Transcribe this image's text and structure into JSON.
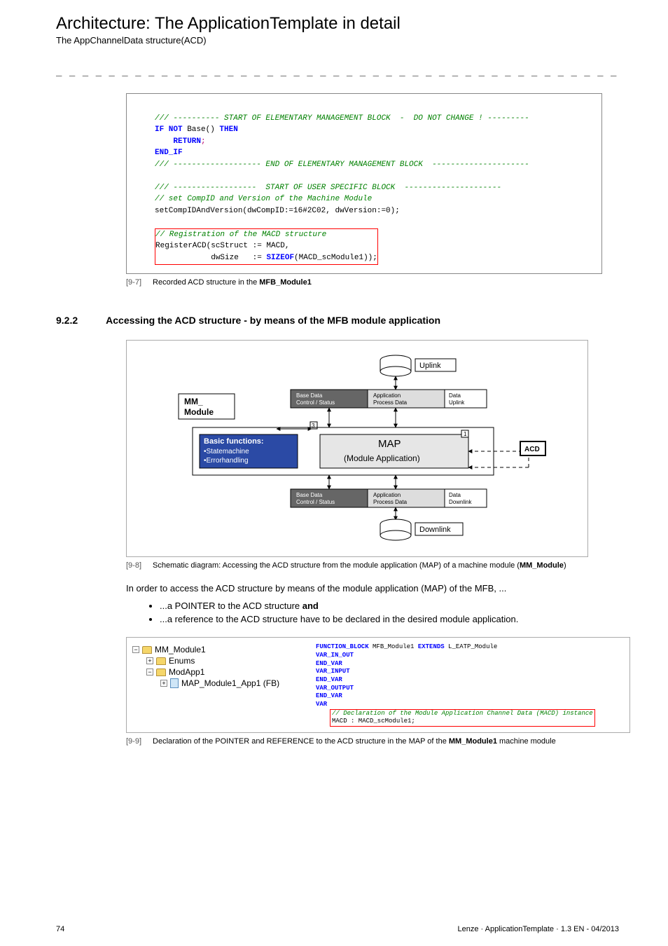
{
  "header": {
    "title": "Architecture: The ApplicationTemplate in detail",
    "subtitle": "The AppChannelData structure(ACD)"
  },
  "dashes": "_ _ _ _ _ _ _ _ _ _ _ _ _ _ _ _ _ _ _ _ _ _ _ _ _ _ _ _ _ _ _ _ _ _ _ _ _ _ _ _ _ _ _ _ _ _ _ _ _ _ _ _ _ _ _ _ _ _ _ _ _ _ _ _",
  "code1": {
    "l1": "/// ---------- START OF ELEMENTARY MANAGEMENT BLOCK  -  DO NOT CHANGE ! ---------",
    "l2a": "IF NOT",
    "l2b": " Base() ",
    "l2c": "THEN",
    "l3": "RETURN",
    "l4": "END_IF",
    "l5": "/// ------------------- END OF ELEMENTARY MANAGEMENT BLOCK  ---------------------",
    "l6": "/// ------------------  START OF USER SPECIFIC BLOCK  ---------------------",
    "l7": "// set CompID and Version of the Machine Module",
    "l8": "setCompIDAndVersion(dwCompID:=16#2C02, dwVersion:=0);",
    "l9": "// Registration of the MACD structure",
    "l10": "RegisterACD(scStruct := MACD,",
    "l11a": "            dwSize   := ",
    "l11b": "SIZEOF",
    "l11c": "(MACD_scModule1));"
  },
  "fig97": {
    "id": "[9-7]",
    "text_a": "Recorded ACD structure in the ",
    "text_b": "MFB_Module1"
  },
  "section922": {
    "num": "9.2.2",
    "title": "Accessing the ACD structure - by means of the MFB module application"
  },
  "diagram": {
    "uplink": "Uplink",
    "mm": "MM_\nModule",
    "basedata1": "Base Data\nControl / Status",
    "app1": "Application\nProcess Data",
    "datauplink": "Data\nUplink",
    "basic": "Basic functions:",
    "basic_b1": "•Statemachine",
    "basic_b2": "•Errorhandling",
    "map": "MAP",
    "mapsub": "(Module Application)",
    "acd": "ACD",
    "basedata2": "Base Data\nControl / Status",
    "app2": "Application\nProcess Data",
    "datadown": "Data\nDownlink",
    "downlink": "Downlink"
  },
  "fig98": {
    "id": "[9-8]",
    "text_a": "Schematic diagram: Accessing the ACD structure from the module application (MAP) of a machine module (",
    "text_b": "MM_Module",
    "text_c": ")"
  },
  "para1": "In order to access the ACD structure by means of the module application (MAP) of the MFB, ...",
  "bullet1a": "...a POINTER to the ACD structure ",
  "bullet1b": "and",
  "bullet2": "...a reference to the ACD structure have to be declared in the desired module application.",
  "tree": {
    "n1": "MM_Module1",
    "n2": "Enums",
    "n3": "ModApp1",
    "n4": "MAP_Module1_App1 (FB)"
  },
  "code2": {
    "l1a": "FUNCTION_BLOCK",
    "l1b": " MFB_Module1 ",
    "l1c": "EXTENDS",
    "l1d": " L_EATP_Module",
    "l2": "VAR_IN_OUT",
    "l3": "END_VAR",
    "l4": "VAR_INPUT",
    "l5": "END_VAR",
    "l6": "VAR_OUTPUT",
    "l7": "END_VAR",
    "l8": "VAR",
    "l9": "// Declaration of the Module Application Channel Data (MACD) instance",
    "l10": "MACD : MACD_scModule1;"
  },
  "fig99": {
    "id": "[9-9]",
    "text_a": "Declaration of the POINTER and REFERENCE to the ACD structure in the MAP of the ",
    "text_b": "MM_Module1",
    "text_c": " machine module"
  },
  "footer": {
    "page": "74",
    "right": "Lenze · ApplicationTemplate · 1.3 EN - 04/2013"
  }
}
